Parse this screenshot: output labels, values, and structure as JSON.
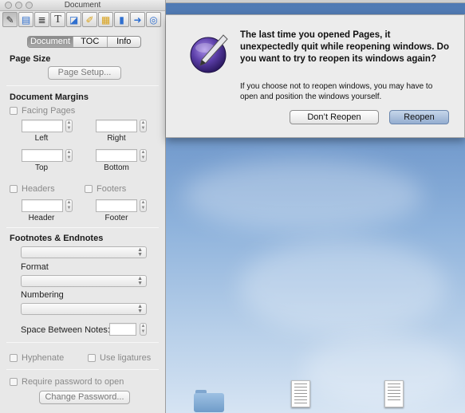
{
  "inspector": {
    "title": "Document",
    "tabs": [
      "Document",
      "TOC",
      "Info"
    ],
    "selected_tab": "Document",
    "toolbar_icons": [
      "document-icon",
      "layout-icon",
      "wrap-icon",
      "text-icon",
      "graphic-icon",
      "metrics-icon",
      "table-icon",
      "chart-icon",
      "link-icon",
      "hyperlink-icon"
    ],
    "page_size": {
      "heading": "Page Size",
      "button": "Page Setup..."
    },
    "margins": {
      "heading": "Document Margins",
      "facing_pages": "Facing Pages",
      "left": "Left",
      "right": "Right",
      "top": "Top",
      "bottom": "Bottom",
      "headers": "Headers",
      "footers": "Footers",
      "header": "Header",
      "footer": "Footer"
    },
    "footnotes": {
      "heading": "Footnotes & Endnotes",
      "format": "Format",
      "numbering": "Numbering",
      "space_between": "Space Between Notes:"
    },
    "hyphenate": "Hyphenate",
    "use_ligatures": "Use ligatures",
    "require_password": "Require password to open",
    "change_password": "Change Password..."
  },
  "alert": {
    "title": "The last time you opened Pages, it unexpectedly quit while reopening windows. Do you want to try to reopen its windows again?",
    "body": "If you choose not to reopen windows, you may have to open and position the windows yourself.",
    "buttons": {
      "dont_reopen": "Don’t Reopen",
      "reopen": "Reopen"
    },
    "default_button": "Reopen"
  },
  "colors": {
    "default_button": "#94add0",
    "desktop_top": "#4f79b3",
    "desktop_bottom": "#d6e4f3"
  }
}
